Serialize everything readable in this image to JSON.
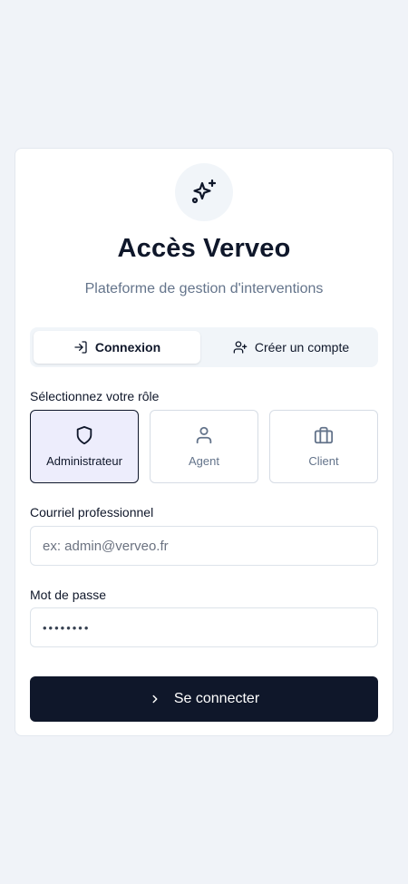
{
  "header": {
    "logo_icon": "sparkles-icon",
    "title": "Accès Verveo",
    "subtitle": "Plateforme de gestion d'interventions"
  },
  "tabs": [
    {
      "label": "Connexion",
      "icon": "log-in-icon",
      "active": true
    },
    {
      "label": "Créer un compte",
      "icon": "user-plus-icon",
      "active": false
    }
  ],
  "roles": {
    "label": "Sélectionnez votre rôle",
    "items": [
      {
        "label": "Administrateur",
        "icon": "shield-icon",
        "selected": true
      },
      {
        "label": "Agent",
        "icon": "user-icon",
        "selected": false
      },
      {
        "label": "Client",
        "icon": "briefcase-icon",
        "selected": false
      }
    ]
  },
  "email": {
    "label": "Courriel professionnel",
    "value": "",
    "placeholder": "ex: admin@verveo.fr"
  },
  "password": {
    "label": "Mot de passe",
    "masked_value": "••••••••"
  },
  "submit": {
    "label": "Se connecter",
    "icon": "chevron-right-icon"
  },
  "colors": {
    "background": "#f0f3f8",
    "primary": "#0f172a",
    "muted_text": "#64748b",
    "selected_role_bg": "#ededfc"
  }
}
